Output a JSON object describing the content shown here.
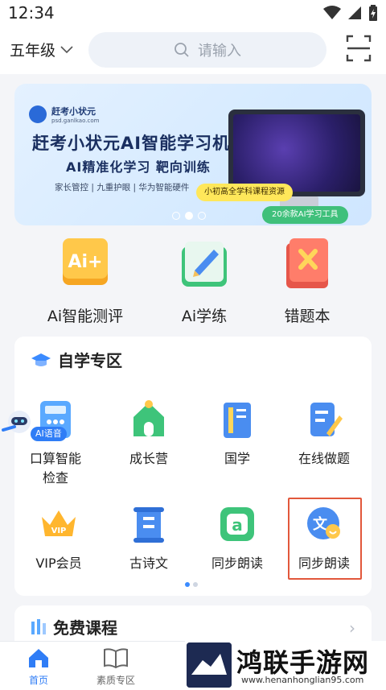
{
  "status_bar": {
    "time": "12:34"
  },
  "top_bar": {
    "grade": "五年级",
    "search_placeholder": "请输入"
  },
  "banner": {
    "brand_name": "赶考小状元",
    "brand_url": "psd.ganlkao.com",
    "title": "赶考小状元AI智能学习机",
    "subtitle": "AI精准化学习 靶向训练",
    "features": "家长管控 | 九重护眼 | 华为智能硬件",
    "tag1": "小初高全学科课程资源",
    "tag2": "20余款AI学习工具"
  },
  "quick_actions": [
    {
      "label": "Ai智能测评"
    },
    {
      "label": "Ai学练"
    },
    {
      "label": "错题本"
    }
  ],
  "self_study": {
    "title": "自学专区",
    "items": [
      {
        "label": "口算智能\n检查"
      },
      {
        "label": "成长营"
      },
      {
        "label": "国学"
      },
      {
        "label": "在线做题"
      },
      {
        "label": "VIP会员"
      },
      {
        "label": "古诗文"
      },
      {
        "label": "同步朗读"
      },
      {
        "label": "同步朗读"
      }
    ]
  },
  "ai_voice": {
    "label": "AI语音"
  },
  "free_courses": {
    "title": "免费课程"
  },
  "bottom_nav": [
    {
      "label": "首页"
    },
    {
      "label": "素质专区"
    }
  ],
  "watermark": {
    "title": "鸿联手游网",
    "url": "www.henanhonglian95.com"
  },
  "colors": {
    "accent": "#2f7df6",
    "highlight": "#e2573b",
    "tag_yellow": "#ffe75a",
    "tag_green": "#3fc07b"
  }
}
